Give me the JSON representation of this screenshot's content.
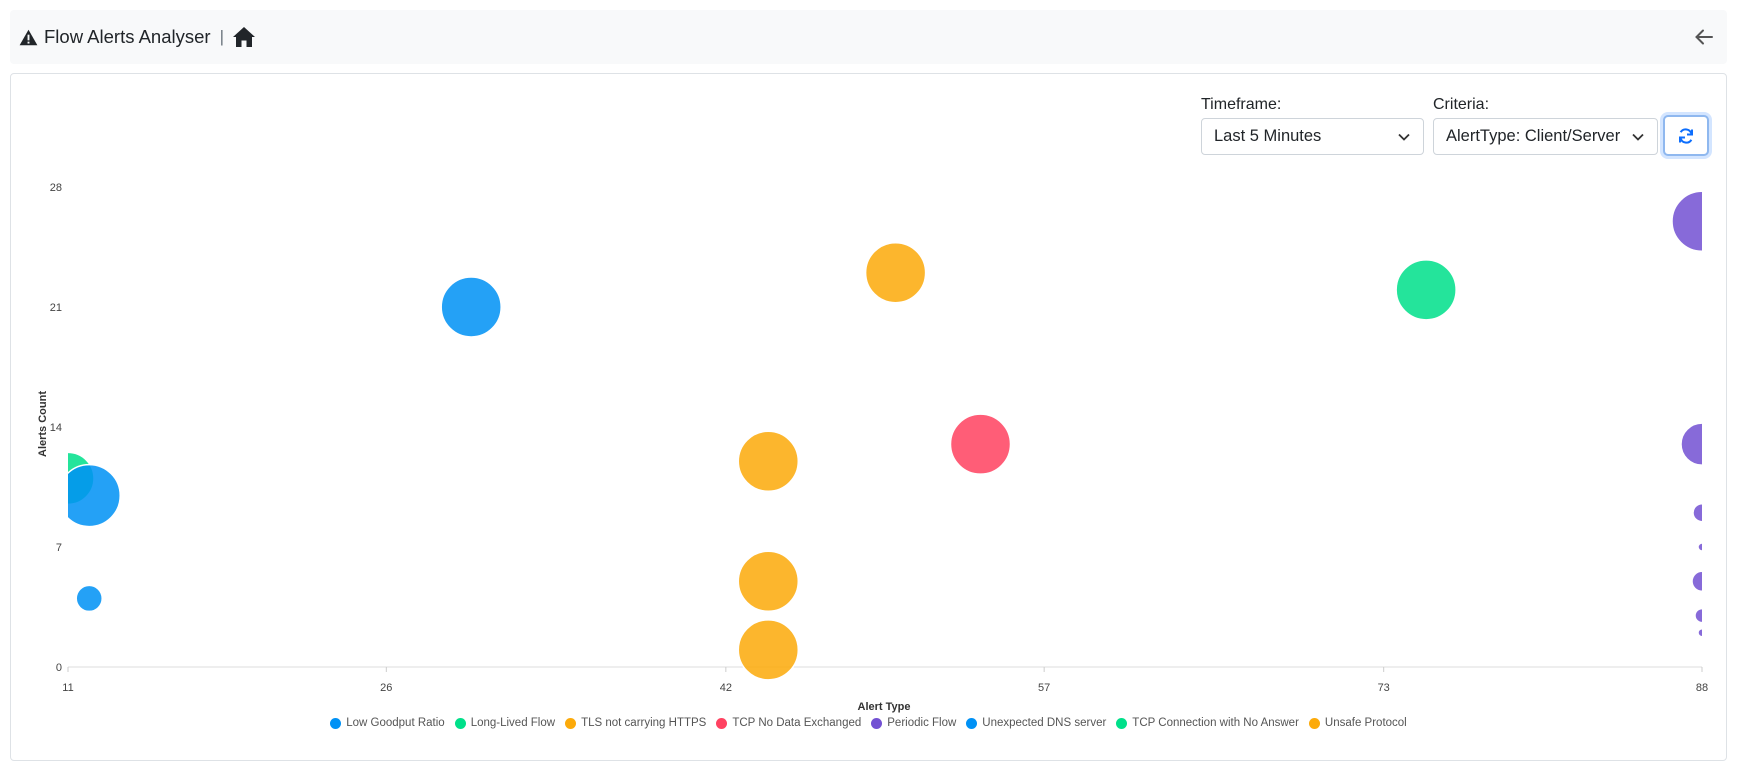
{
  "header": {
    "title": "Flow Alerts Analyser"
  },
  "controls": {
    "timeframe_label": "Timeframe:",
    "timeframe_value": "Last 5 Minutes",
    "criteria_label": "Criteria:",
    "criteria_value": "AlertType: Client/Server"
  },
  "colors": {
    "blue": "#0091f5",
    "green": "#00e08a",
    "orange": "#fcaa0a",
    "red": "#ff4261",
    "purple": "#7351d3",
    "accent": "#0d6efd"
  },
  "chart_data": {
    "type": "scatter",
    "xlabel": "Alert Type",
    "ylabel": "Alerts Count",
    "xlim": [
      11,
      88
    ],
    "ylim": [
      0,
      28
    ],
    "x_ticks": [
      "11",
      "26",
      "42",
      "57",
      "73",
      "88"
    ],
    "y_ticks": [
      "0",
      "7",
      "14",
      "21",
      "28"
    ],
    "legend_position": "bottom",
    "series": [
      {
        "name": "Low Goodput Ratio",
        "color": "#0091f5",
        "points": [
          {
            "x": 30,
            "y": 21,
            "r": 30
          }
        ]
      },
      {
        "name": "Long-Lived Flow",
        "color": "#00e08a",
        "points": [
          {
            "x": 11,
            "y": 11,
            "r": 26
          }
        ]
      },
      {
        "name": "TLS not carrying HTTPS",
        "color": "#fcaa0a",
        "points": [
          {
            "x": 50,
            "y": 23,
            "r": 30
          }
        ]
      },
      {
        "name": "TCP No Data Exchanged",
        "color": "#ff4261",
        "points": [
          {
            "x": 54,
            "y": 13,
            "r": 30
          }
        ]
      },
      {
        "name": "Periodic Flow",
        "color": "#7351d3",
        "points": [
          {
            "x": 88,
            "y": 26,
            "r": 30
          },
          {
            "x": 88,
            "y": 13,
            "r": 21
          },
          {
            "x": 88,
            "y": 9,
            "r": 9
          },
          {
            "x": 88,
            "y": 7,
            "r": 4
          },
          {
            "x": 88,
            "y": 5,
            "r": 10
          },
          {
            "x": 88,
            "y": 3,
            "r": 7
          },
          {
            "x": 88,
            "y": 2,
            "r": 4
          }
        ]
      },
      {
        "name": "Unexpected DNS server",
        "color": "#0091f5",
        "points": [
          {
            "x": 12,
            "y": 10,
            "r": 31
          },
          {
            "x": 12,
            "y": 4,
            "r": 13
          }
        ]
      },
      {
        "name": "TCP Connection with No Answer",
        "color": "#00e08a",
        "points": [
          {
            "x": 75,
            "y": 22,
            "r": 30
          }
        ]
      },
      {
        "name": "Unsafe Protocol",
        "color": "#fcaa0a",
        "points": [
          {
            "x": 44,
            "y": 12,
            "r": 30
          },
          {
            "x": 44,
            "y": 5,
            "r": 30
          },
          {
            "x": 44,
            "y": 1,
            "r": 30
          }
        ]
      }
    ]
  }
}
